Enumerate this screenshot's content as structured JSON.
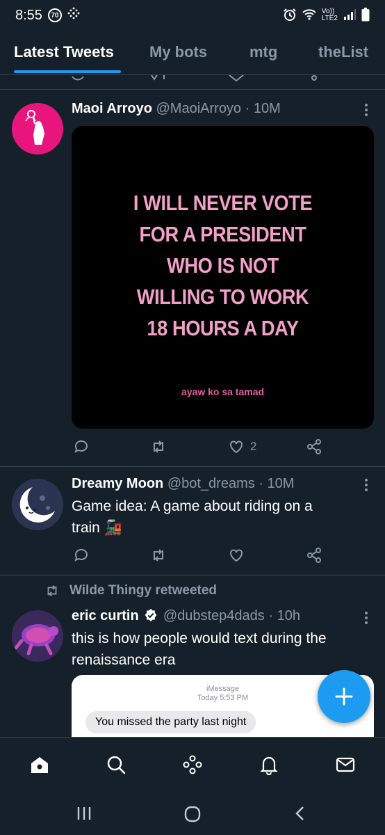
{
  "status_bar": {
    "time": "8:55",
    "badge": "70",
    "network_line1": "Vo))",
    "network_line2": "LTE2"
  },
  "tabs": [
    "Latest Tweets",
    "My bots",
    "mtg",
    "theList"
  ],
  "tweets": [
    {
      "name": "Maoi Arroyo",
      "handle": "@MaoiArroyo",
      "sep": "·",
      "time": "10M",
      "image_text_lines": [
        "I WILL NEVER VOTE",
        "FOR A PRESIDENT",
        "WHO IS NOT",
        "WILLING TO WORK",
        "18 HOURS A DAY"
      ],
      "image_credit": "ayaw ko sa tamad",
      "like_count": "2"
    },
    {
      "name": "Dreamy Moon",
      "handle": "@bot_dreams",
      "sep": "·",
      "time": "10M",
      "text_line1": "Game idea: A game about riding on a",
      "text_line2": "train 🚂"
    },
    {
      "retweeted_by": "Wilde Thingy retweeted",
      "name": "eric curtin",
      "handle": "@dubstep4dads",
      "sep": "·",
      "time": "10h",
      "text_line1": "this is how people would text during the",
      "text_line2": "renaissance era",
      "imessage_label": "iMessage",
      "imessage_time": "Today 5:53 PM",
      "bubble_text": "You missed the party last night"
    }
  ],
  "colors": {
    "background": "#15202b",
    "accent": "#1d9bf0",
    "muted": "#8b98a5",
    "divider": "#38444d"
  },
  "icons": [
    "home-icon",
    "search-icon",
    "spaces-icon",
    "bell-icon",
    "mail-icon",
    "compose-plus-icon"
  ]
}
